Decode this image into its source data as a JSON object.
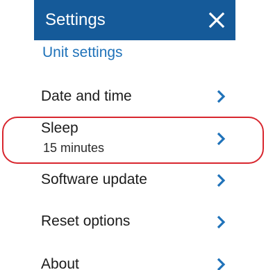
{
  "header": {
    "title": "Settings",
    "close_icon": "close-icon",
    "background": "#155a99"
  },
  "section": {
    "label": "Unit settings",
    "color": "#1f72b9"
  },
  "menu": {
    "items": [
      {
        "label": "Date and time",
        "icon": "chevron-right-icon"
      },
      {
        "label": "Sleep",
        "sublabel": "15 minutes",
        "icon": "chevron-right-icon"
      },
      {
        "label": "Software update",
        "icon": "chevron-right-icon"
      },
      {
        "label": "Reset options",
        "icon": "chevron-right-icon"
      },
      {
        "label": "About",
        "icon": "chevron-right-icon"
      }
    ]
  },
  "accent_color": "#1f72b9",
  "highlight_color": "#d8262e"
}
